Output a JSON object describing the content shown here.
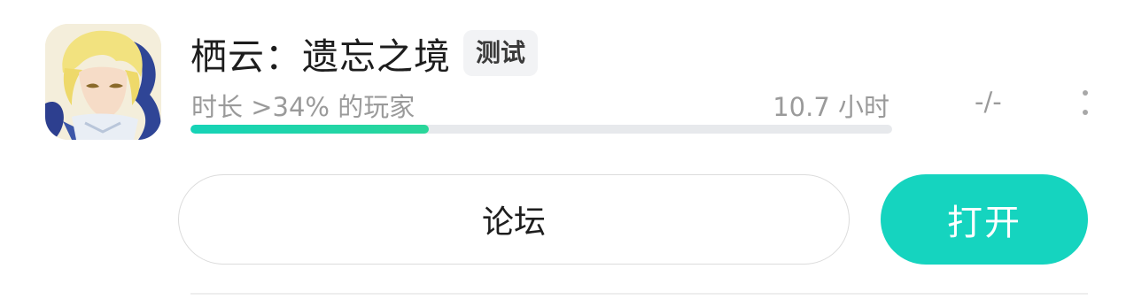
{
  "game": {
    "title": "栖云：遗忘之境",
    "tag": "测试",
    "stats": "时长 >34% 的玩家",
    "hours": "10.7 小时",
    "score": "-/-",
    "progress_percent": 34
  },
  "actions": {
    "forum_label": "论坛",
    "open_label": "打开"
  },
  "colors": {
    "accent": "#15d4bf",
    "progress_track": "#e7e9ec"
  },
  "icons": {
    "app_icon": "game-cover-icon",
    "menu": "more-vertical-icon"
  }
}
